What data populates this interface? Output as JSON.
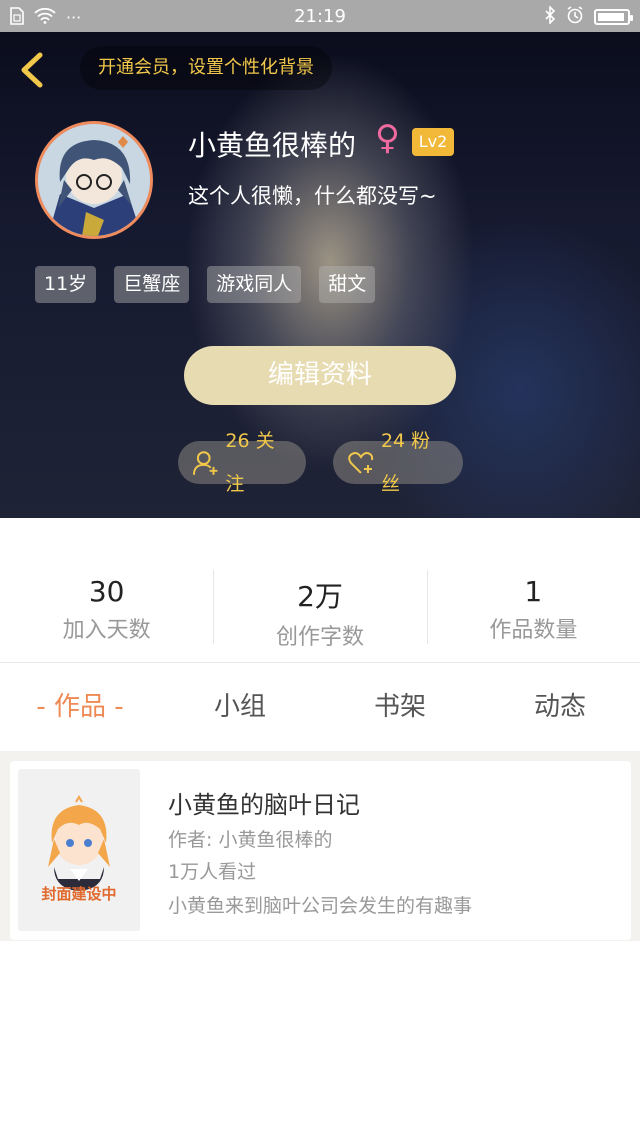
{
  "status_bar": {
    "time": "21:19",
    "dots": "···"
  },
  "header": {
    "vip_banner": "开通会员，设置个性化背景",
    "nickname": "小黄鱼很棒的",
    "gender_symbol": "♀",
    "level": "Lv2",
    "signature": "这个人很懒，什么都没写~",
    "tags": [
      "11岁",
      "巨蟹座",
      "游戏同人",
      "甜文"
    ],
    "edit_button": "编辑资料",
    "follow_count": "26 关注",
    "fans_count": "24 粉丝",
    "accent_color": "#f2c84b",
    "avatar_border_color": "#f08b5d"
  },
  "stats": [
    {
      "value": "30",
      "label": "加入天数"
    },
    {
      "value": "2万",
      "label": "创作字数"
    },
    {
      "value": "1",
      "label": "作品数量"
    }
  ],
  "tabs": [
    {
      "label": "- 作品 -",
      "active": true
    },
    {
      "label": "小组",
      "active": false
    },
    {
      "label": "书架",
      "active": false
    },
    {
      "label": "动态",
      "active": false
    }
  ],
  "works": [
    {
      "cover_text": "封面建设中",
      "title": "小黄鱼的脑叶日记",
      "author": "作者: 小黄鱼很棒的",
      "views": "1万人看过",
      "description": "小黄鱼来到脑叶公司会发生的有趣事"
    }
  ]
}
